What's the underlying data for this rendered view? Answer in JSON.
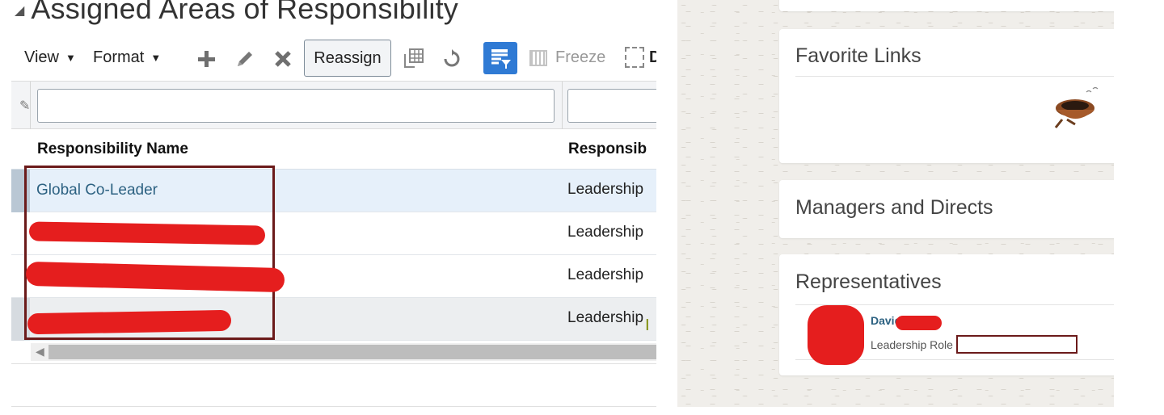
{
  "section": {
    "title": "Assigned Areas of Responsibility"
  },
  "toolbar": {
    "view_label": "View",
    "format_label": "Format",
    "reassign_label": "Reassign",
    "freeze_label": "Freeze",
    "detach_label": "D"
  },
  "table": {
    "columns": [
      "Responsibility Name",
      "Responsib"
    ],
    "rows": [
      {
        "name": "Global Co-Leader",
        "type": "Leadership"
      },
      {
        "name": "",
        "type": "Leadership"
      },
      {
        "name": "",
        "type": "Leadership"
      },
      {
        "name": "",
        "type": "Leadership"
      }
    ]
  },
  "right_panel": {
    "favorite_links_title": "Favorite Links",
    "managers_title": "Managers and Directs",
    "representatives_title": "Representatives",
    "rep_name": "David",
    "rep_role": "Leadership Role"
  },
  "colors": {
    "link": "#2d6282",
    "accent_button": "#2f7ad4",
    "selected_row": "#e6f0fa",
    "redaction": "#e51e1e",
    "highlight_border": "#6b1a1a"
  }
}
